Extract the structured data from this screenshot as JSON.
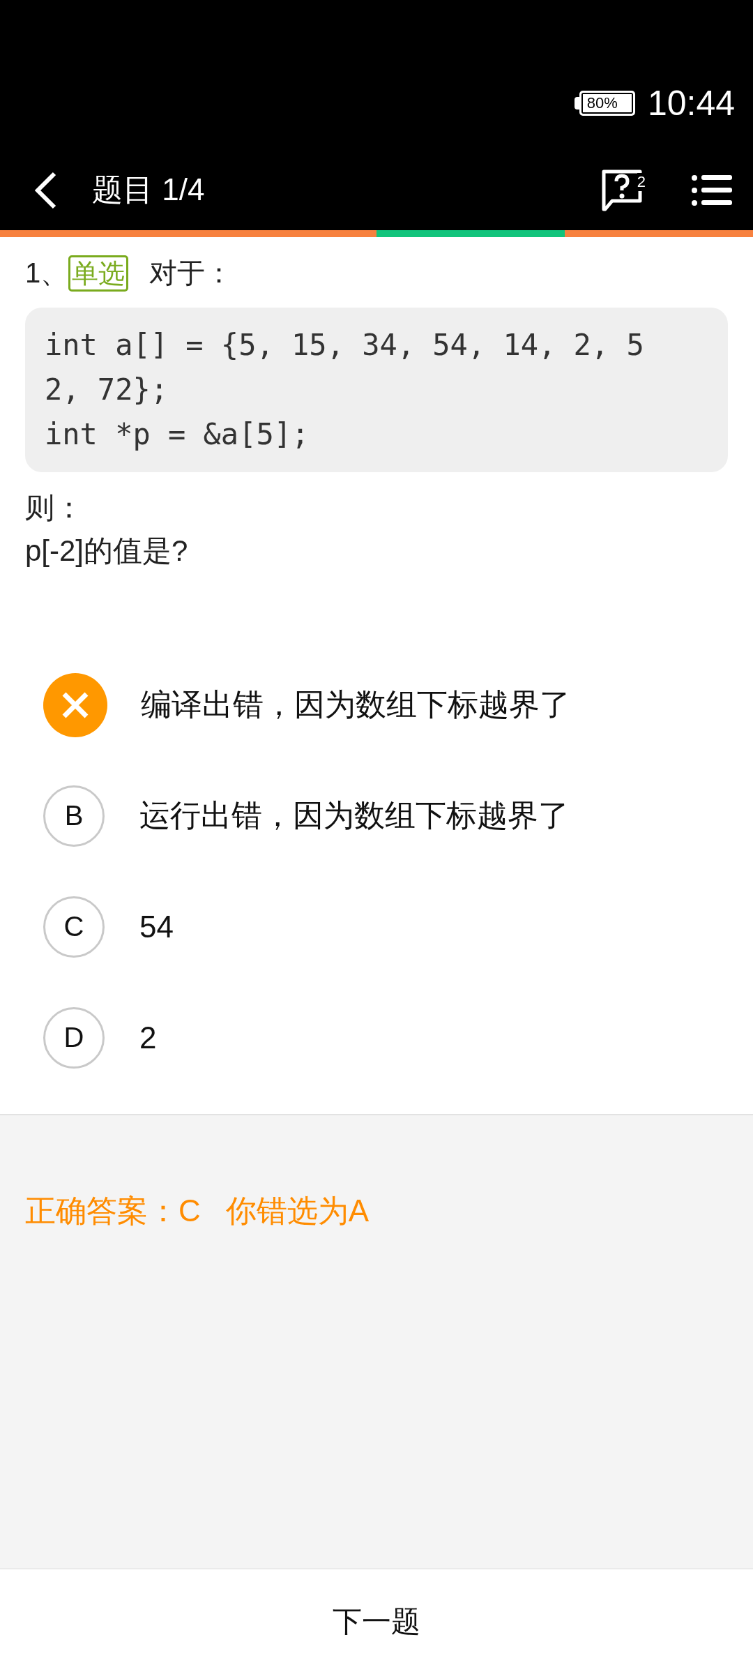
{
  "status_bar": {
    "battery": "80%",
    "time": "10:44"
  },
  "header": {
    "title": "题目 1/4",
    "feedback_badge": "2"
  },
  "progress": [
    {
      "color": "#f7813f"
    },
    {
      "color": "#f7813f"
    },
    {
      "color": "#12c47c"
    },
    {
      "color": "#f7813f"
    }
  ],
  "question": {
    "number": "1、",
    "tag": "单选",
    "intro": "对于：",
    "code": "int a[] = {5, 15, 34, 54, 14, 2, 5\n2, 72};\nint *p = &a[5];",
    "lines": [
      "则：",
      "p[-2]的值是?"
    ]
  },
  "options": [
    {
      "text": "编译出错，因为数组下标越界了",
      "selected": true
    },
    {
      "letter": "B",
      "text": "运行出错，因为数组下标越界了",
      "selected": false
    },
    {
      "letter": "C",
      "text": "54",
      "selected": false
    },
    {
      "letter": "D",
      "text": "2",
      "selected": false
    }
  ],
  "result": {
    "correct_answer": "正确答案：C",
    "your_answer": "你错选为A"
  },
  "bottom": {
    "next_button": "下一题"
  }
}
